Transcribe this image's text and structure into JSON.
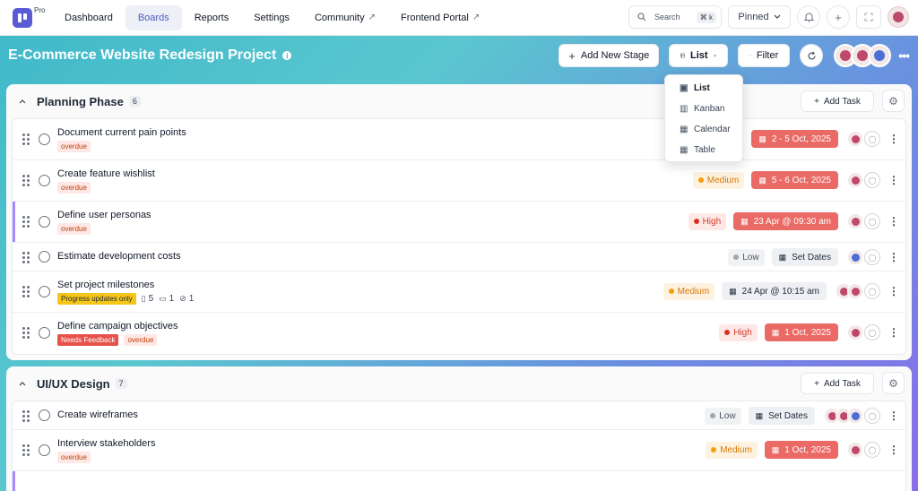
{
  "nav": {
    "plan_badge": "Pro",
    "links": [
      "Dashboard",
      "Boards",
      "Reports",
      "Settings",
      "Community",
      "Frontend Portal"
    ],
    "search_label": "Search",
    "search_kbd": "⌘ k",
    "pinned_label": "Pinned"
  },
  "project": {
    "title": "E-Commerce Website Redesign Project",
    "add_stage_label": "Add New Stage",
    "view_label": "List",
    "filter_label": "Filter"
  },
  "view_menu": {
    "options": [
      "List",
      "Kanban",
      "Calendar",
      "Table"
    ],
    "selected": "List"
  },
  "sections": [
    {
      "title": "Planning Phase",
      "count": "6",
      "add_task_label": "Add Task",
      "tasks": [
        {
          "name": "Document current pain points",
          "tags": [
            "overdue"
          ],
          "priority": "",
          "date": "2 - 5 Oct, 2025"
        },
        {
          "name": "Create feature wishlist",
          "tags": [
            "overdue"
          ],
          "priority": "Medium",
          "date": "5 - 6 Oct, 2025"
        },
        {
          "name": "Define user personas",
          "tags": [
            "overdue"
          ],
          "priority": "High",
          "date": "23 Apr @ 09:30 am"
        },
        {
          "name": "Estimate development costs",
          "tags": [],
          "priority": "Low",
          "date": "Set Dates"
        },
        {
          "name": "Set project milestones",
          "tags": [
            "Progress updates only"
          ],
          "subtasks": "5",
          "comments": "1",
          "attachments": "1",
          "priority": "Medium",
          "date": "24 Apr @ 10:15 am"
        },
        {
          "name": "Define campaign objectives",
          "tags": [
            "Needs Feedback",
            "overdue"
          ],
          "priority": "High",
          "date": "1 Oct, 2025"
        }
      ]
    },
    {
      "title": "UI/UX Design",
      "count": "7",
      "add_task_label": "Add Task",
      "tasks": [
        {
          "name": "Create wireframes",
          "tags": [],
          "priority": "Low",
          "date": "Set Dates"
        },
        {
          "name": "Interview stakeholders",
          "tags": [
            "overdue"
          ],
          "priority": "Medium",
          "date": "1 Oct, 2025"
        }
      ]
    }
  ],
  "colors": {
    "brand": "#5b5bd6",
    "overdue_date": "#ea6a65",
    "priority_high": "#d93025",
    "priority_medium": "#f59e0b",
    "priority_low": "#a1a7b0"
  },
  "icons": [
    "search-icon",
    "chevron-down-icon",
    "bell-icon",
    "plus-icon",
    "expand-icon",
    "info-icon",
    "chevron-up-icon",
    "filter-icon",
    "refresh-icon",
    "more-icon",
    "gear-icon",
    "calendar-icon",
    "drag-handle-icon",
    "kebab-icon",
    "list-icon",
    "kanban-icon",
    "table-icon",
    "user-placeholder-icon"
  ]
}
